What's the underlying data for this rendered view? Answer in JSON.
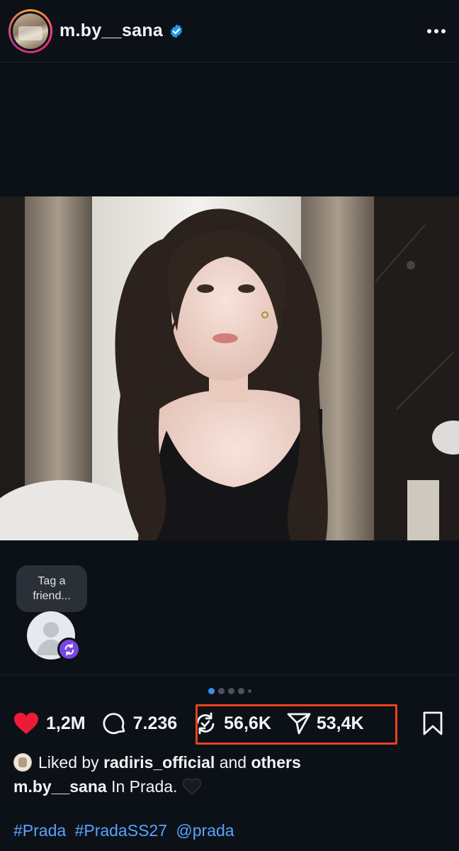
{
  "header": {
    "username": "m.by__sana",
    "more_icon": "more-horizontal-icon",
    "verified_icon": "verified-badge-icon"
  },
  "tag_prompt": {
    "line1": "Tag a",
    "line2": "friend..."
  },
  "carousel": {
    "dot_count": 5,
    "active_index": 0
  },
  "actions": {
    "likes": "1,2M",
    "comments": "7.236",
    "reposts": "56,6K",
    "shares": "53,4K"
  },
  "liked_by": {
    "prefix": "Liked by",
    "user": "radiris_official",
    "connector": "and",
    "others": "others"
  },
  "caption": {
    "username": "m.by__sana",
    "text": "In Prada."
  },
  "hashtags": [
    "#Prada",
    "#PradaSS27",
    "@prada"
  ],
  "colors": {
    "background": "#0c1117",
    "like_red": "#ed1c36",
    "link_blue": "#5aa2ff",
    "highlight_orange": "#e8421a",
    "badge_purple": "#7b45e4"
  }
}
